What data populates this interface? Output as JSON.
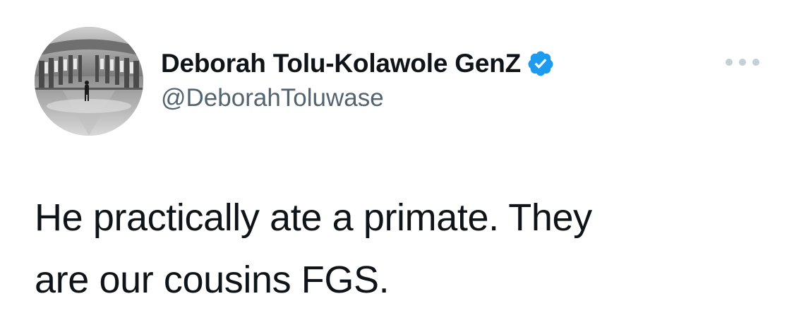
{
  "author": {
    "display_name": "Deborah Tolu-Kolawole GenZ",
    "handle": "@DeborahToluwase",
    "verified": true,
    "avatar": "avatar-photo",
    "verified_badge_icon": "verified-badge-icon",
    "verified_color": "#1d9bf0"
  },
  "tweet": {
    "text_lines": [
      "He practically ate a primate. They",
      "are our cousins FGS."
    ]
  },
  "controls": {
    "more_icon": "more-options-icon"
  }
}
